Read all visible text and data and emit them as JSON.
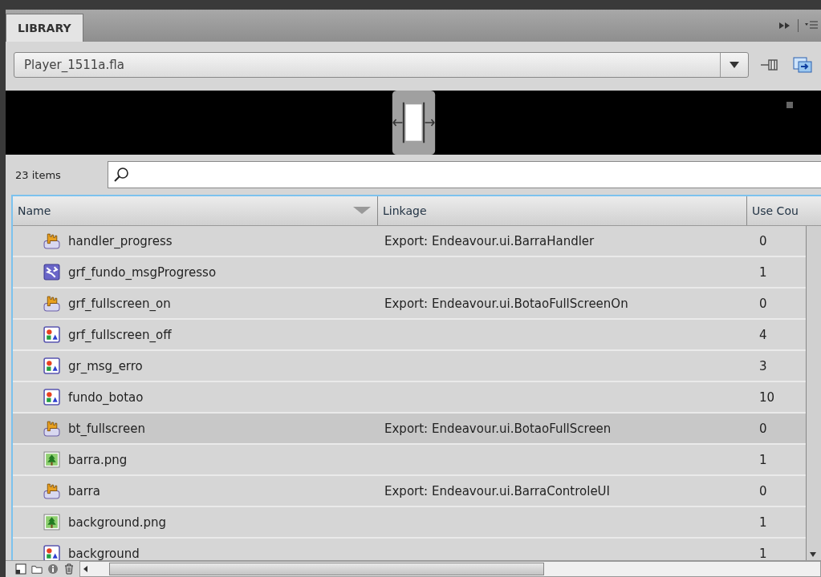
{
  "panel": {
    "tab": "LIBRARY"
  },
  "document": {
    "value": "Player_1511a.fla"
  },
  "status": {
    "count": "23 items"
  },
  "table": {
    "columns": [
      "Name",
      "Linkage",
      "Use Cou"
    ],
    "rows": [
      {
        "kind": "button",
        "name": "handler_progress",
        "linkage": "Export: Endeavour.ui.BarraHandler",
        "count": "0",
        "selected": false
      },
      {
        "kind": "component",
        "name": "grf_fundo_msgProgresso",
        "count": "1",
        "selected": false
      },
      {
        "kind": "button",
        "name": "grf_fullscreen_on",
        "linkage": "Export: Endeavour.ui.BotaoFullScreenOn",
        "count": "0",
        "selected": false
      },
      {
        "kind": "graphic",
        "name": "grf_fullscreen_off",
        "count": "4",
        "selected": false
      },
      {
        "kind": "graphic",
        "name": "gr_msg_erro",
        "count": "3",
        "selected": false
      },
      {
        "kind": "graphic",
        "name": "fundo_botao",
        "count": "10",
        "selected": false
      },
      {
        "kind": "button",
        "name": "bt_fullscreen",
        "linkage": "Export: Endeavour.ui.BotaoFullScreen",
        "count": "0",
        "selected": true
      },
      {
        "kind": "bitmap",
        "name": "barra.png",
        "count": "1",
        "selected": false
      },
      {
        "kind": "button",
        "name": "barra",
        "linkage": "Export: Endeavour.ui.BarraControleUI",
        "count": "0",
        "selected": false
      },
      {
        "kind": "bitmap",
        "name": "background.png",
        "count": "1",
        "selected": false
      },
      {
        "kind": "graphic",
        "name": "background",
        "count": "1",
        "selected": false
      }
    ]
  }
}
